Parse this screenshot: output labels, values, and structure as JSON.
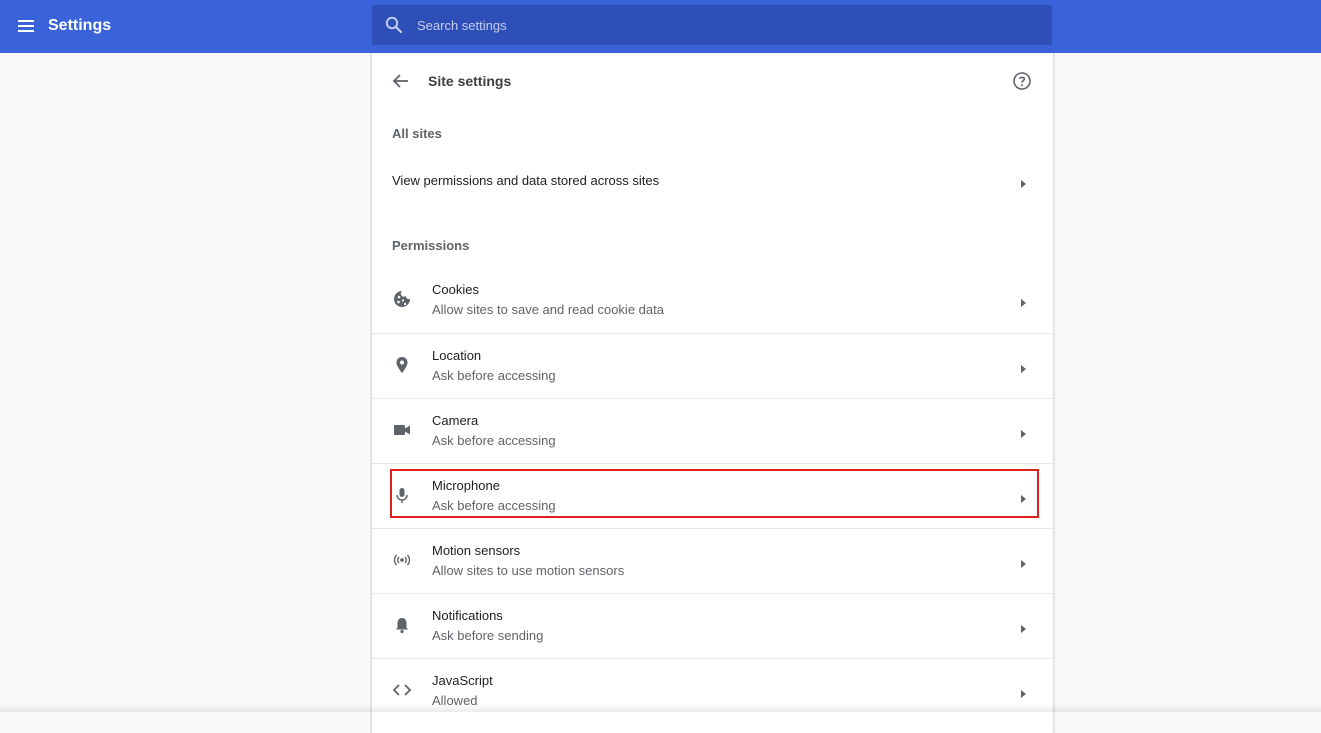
{
  "app": {
    "title": "Settings",
    "menu_icon": "hamburger-menu-icon",
    "brand_color": "#3b63d9"
  },
  "search": {
    "placeholder": "Search settings",
    "value": "",
    "icon": "search-icon"
  },
  "page": {
    "title": "Site settings",
    "back_icon": "arrow-left-icon",
    "help_icon": "help-circle-icon"
  },
  "all_sites": {
    "heading": "All sites",
    "row_label": "View permissions and data stored across sites"
  },
  "permissions": {
    "heading": "Permissions",
    "items": [
      {
        "title": "Cookies",
        "subtitle": "Allow sites to save and read cookie data",
        "icon": "cookie-icon"
      },
      {
        "title": "Location",
        "subtitle": "Ask before accessing",
        "icon": "location-pin-icon"
      },
      {
        "title": "Camera",
        "subtitle": "Ask before accessing",
        "icon": "camera-icon"
      },
      {
        "title": "Microphone",
        "subtitle": "Ask before accessing",
        "icon": "microphone-icon",
        "highlighted": true,
        "highlight_color": "#e0211b"
      },
      {
        "title": "Motion sensors",
        "subtitle": "Allow sites to use motion sensors",
        "icon": "motion-sensors-icon"
      },
      {
        "title": "Notifications",
        "subtitle": "Ask before sending",
        "icon": "bell-icon"
      },
      {
        "title": "JavaScript",
        "subtitle": "Allowed",
        "icon": "code-brackets-icon"
      }
    ]
  }
}
